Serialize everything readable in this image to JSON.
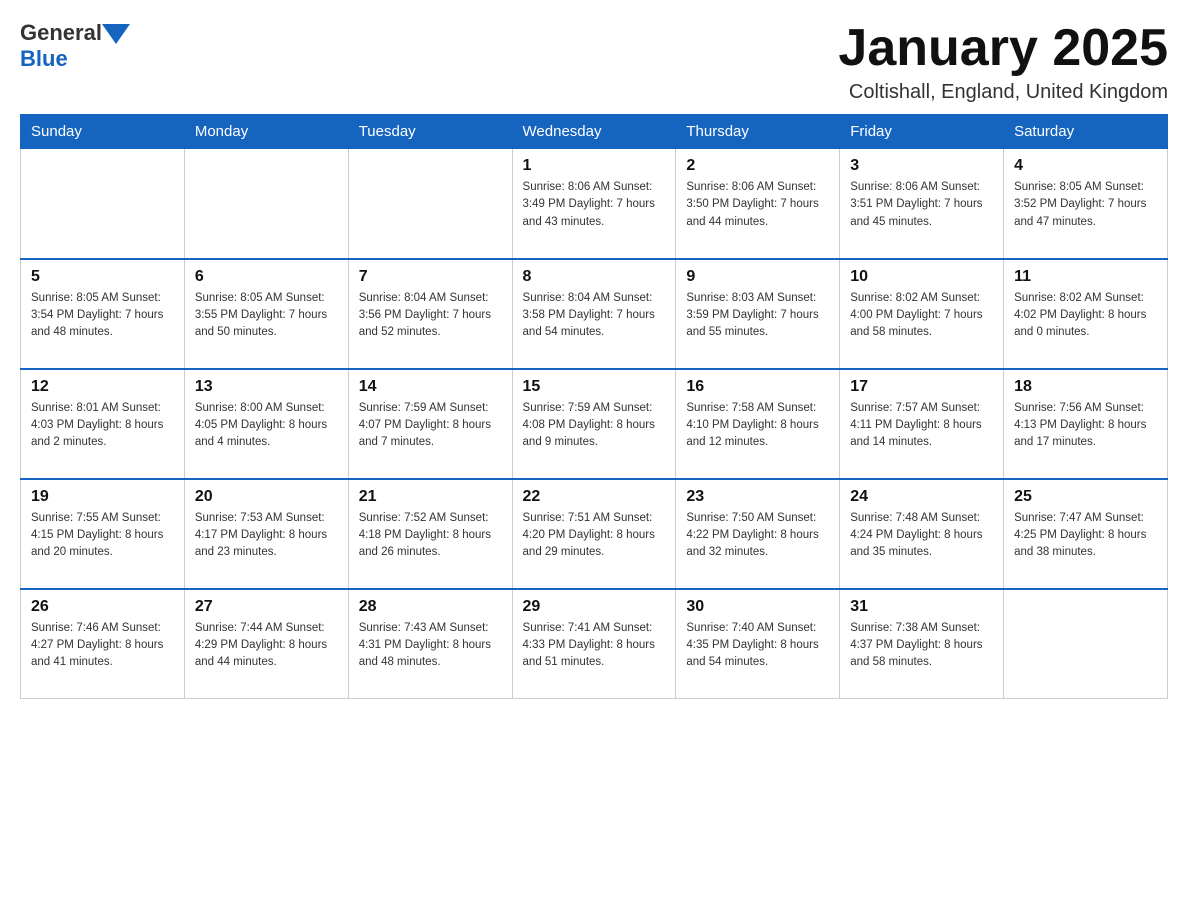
{
  "logo": {
    "general": "General",
    "blue": "Blue"
  },
  "title": "January 2025",
  "location": "Coltishall, England, United Kingdom",
  "days_of_week": [
    "Sunday",
    "Monday",
    "Tuesday",
    "Wednesday",
    "Thursday",
    "Friday",
    "Saturday"
  ],
  "weeks": [
    [
      {
        "day": "",
        "info": ""
      },
      {
        "day": "",
        "info": ""
      },
      {
        "day": "",
        "info": ""
      },
      {
        "day": "1",
        "info": "Sunrise: 8:06 AM\nSunset: 3:49 PM\nDaylight: 7 hours\nand 43 minutes."
      },
      {
        "day": "2",
        "info": "Sunrise: 8:06 AM\nSunset: 3:50 PM\nDaylight: 7 hours\nand 44 minutes."
      },
      {
        "day": "3",
        "info": "Sunrise: 8:06 AM\nSunset: 3:51 PM\nDaylight: 7 hours\nand 45 minutes."
      },
      {
        "day": "4",
        "info": "Sunrise: 8:05 AM\nSunset: 3:52 PM\nDaylight: 7 hours\nand 47 minutes."
      }
    ],
    [
      {
        "day": "5",
        "info": "Sunrise: 8:05 AM\nSunset: 3:54 PM\nDaylight: 7 hours\nand 48 minutes."
      },
      {
        "day": "6",
        "info": "Sunrise: 8:05 AM\nSunset: 3:55 PM\nDaylight: 7 hours\nand 50 minutes."
      },
      {
        "day": "7",
        "info": "Sunrise: 8:04 AM\nSunset: 3:56 PM\nDaylight: 7 hours\nand 52 minutes."
      },
      {
        "day": "8",
        "info": "Sunrise: 8:04 AM\nSunset: 3:58 PM\nDaylight: 7 hours\nand 54 minutes."
      },
      {
        "day": "9",
        "info": "Sunrise: 8:03 AM\nSunset: 3:59 PM\nDaylight: 7 hours\nand 55 minutes."
      },
      {
        "day": "10",
        "info": "Sunrise: 8:02 AM\nSunset: 4:00 PM\nDaylight: 7 hours\nand 58 minutes."
      },
      {
        "day": "11",
        "info": "Sunrise: 8:02 AM\nSunset: 4:02 PM\nDaylight: 8 hours\nand 0 minutes."
      }
    ],
    [
      {
        "day": "12",
        "info": "Sunrise: 8:01 AM\nSunset: 4:03 PM\nDaylight: 8 hours\nand 2 minutes."
      },
      {
        "day": "13",
        "info": "Sunrise: 8:00 AM\nSunset: 4:05 PM\nDaylight: 8 hours\nand 4 minutes."
      },
      {
        "day": "14",
        "info": "Sunrise: 7:59 AM\nSunset: 4:07 PM\nDaylight: 8 hours\nand 7 minutes."
      },
      {
        "day": "15",
        "info": "Sunrise: 7:59 AM\nSunset: 4:08 PM\nDaylight: 8 hours\nand 9 minutes."
      },
      {
        "day": "16",
        "info": "Sunrise: 7:58 AM\nSunset: 4:10 PM\nDaylight: 8 hours\nand 12 minutes."
      },
      {
        "day": "17",
        "info": "Sunrise: 7:57 AM\nSunset: 4:11 PM\nDaylight: 8 hours\nand 14 minutes."
      },
      {
        "day": "18",
        "info": "Sunrise: 7:56 AM\nSunset: 4:13 PM\nDaylight: 8 hours\nand 17 minutes."
      }
    ],
    [
      {
        "day": "19",
        "info": "Sunrise: 7:55 AM\nSunset: 4:15 PM\nDaylight: 8 hours\nand 20 minutes."
      },
      {
        "day": "20",
        "info": "Sunrise: 7:53 AM\nSunset: 4:17 PM\nDaylight: 8 hours\nand 23 minutes."
      },
      {
        "day": "21",
        "info": "Sunrise: 7:52 AM\nSunset: 4:18 PM\nDaylight: 8 hours\nand 26 minutes."
      },
      {
        "day": "22",
        "info": "Sunrise: 7:51 AM\nSunset: 4:20 PM\nDaylight: 8 hours\nand 29 minutes."
      },
      {
        "day": "23",
        "info": "Sunrise: 7:50 AM\nSunset: 4:22 PM\nDaylight: 8 hours\nand 32 minutes."
      },
      {
        "day": "24",
        "info": "Sunrise: 7:48 AM\nSunset: 4:24 PM\nDaylight: 8 hours\nand 35 minutes."
      },
      {
        "day": "25",
        "info": "Sunrise: 7:47 AM\nSunset: 4:25 PM\nDaylight: 8 hours\nand 38 minutes."
      }
    ],
    [
      {
        "day": "26",
        "info": "Sunrise: 7:46 AM\nSunset: 4:27 PM\nDaylight: 8 hours\nand 41 minutes."
      },
      {
        "day": "27",
        "info": "Sunrise: 7:44 AM\nSunset: 4:29 PM\nDaylight: 8 hours\nand 44 minutes."
      },
      {
        "day": "28",
        "info": "Sunrise: 7:43 AM\nSunset: 4:31 PM\nDaylight: 8 hours\nand 48 minutes."
      },
      {
        "day": "29",
        "info": "Sunrise: 7:41 AM\nSunset: 4:33 PM\nDaylight: 8 hours\nand 51 minutes."
      },
      {
        "day": "30",
        "info": "Sunrise: 7:40 AM\nSunset: 4:35 PM\nDaylight: 8 hours\nand 54 minutes."
      },
      {
        "day": "31",
        "info": "Sunrise: 7:38 AM\nSunset: 4:37 PM\nDaylight: 8 hours\nand 58 minutes."
      },
      {
        "day": "",
        "info": ""
      }
    ]
  ]
}
